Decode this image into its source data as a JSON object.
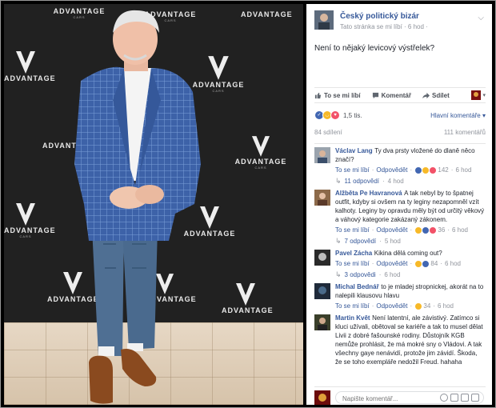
{
  "photo": {
    "brand_word": "ADVANTAGE",
    "brand_sub": "CARS"
  },
  "post": {
    "page_name": "Český politický bizár",
    "meta": "Tato stránka se mi líbí · 6 hod ·",
    "text": "Není to nějaký levicový výstřelek?",
    "actions": {
      "like": "To se mi líbí",
      "comment": "Komentář",
      "share": "Sdílet"
    },
    "reactions_count": "1,5 tis.",
    "sort_label": "Hlavní komentáře ▾",
    "shares": "84 sdílení",
    "comments_count": "111 komentářů"
  },
  "comments": [
    {
      "author": "Václav Lang",
      "text": "Ty dva prsty vložené do dlaně něco značí?",
      "like": "To se mi líbí",
      "reply": "Odpovědět",
      "reactions": "142",
      "time": "6 hod",
      "replies": "11 odpovědí",
      "replies_time": "4 hod"
    },
    {
      "author": "Alžběta Pe Havranová",
      "text": "A tak nebyl by to špatnej outfit, kdyby si ovšem na ty leginy nezapomněl vzít kalhoty. Leginy by opravdu měly být od určitý věkový a váhový kategorie zakázaný zákonem.",
      "like": "To se mi líbí",
      "reply": "Odpovědět",
      "reactions": "36",
      "time": "6 hod",
      "replies": "7 odpovědí",
      "replies_time": "5 hod"
    },
    {
      "author": "Pavel Zácha",
      "text": "Kikina dělá coming out?",
      "like": "To se mi líbí",
      "reply": "Odpovědět",
      "reactions": "84",
      "time": "6 hod",
      "replies": "3 odpovědi",
      "replies_time": "6 hod"
    },
    {
      "author": "Michal Bednář",
      "text": "to je mladej stropnickej, akorát na to nalepili klausovu hlavu",
      "like": "To se mi líbí",
      "reply": "Odpovědět",
      "reactions": "34",
      "time": "6 hod"
    },
    {
      "author": "Martin Květ",
      "text": "Není latentní, ale závistivý. Zatímco si kluci užívali, obětoval se kariéře a tak to musel dělat Livii z dobré fašounské rodiny. Důstojník KGB nemůže prohlásit, že má mokré sny o Vládovi. A tak všechny gaye nenávidí, protože jim závidí. Škoda, že se toho exempláře nedožil Freud. hahaha"
    }
  ],
  "composer": {
    "placeholder": "Napište komentář..."
  },
  "colors": {
    "link": "#365899",
    "like_blue": "#4267b2",
    "haha_yellow": "#f7b928",
    "love_red": "#f25268"
  }
}
